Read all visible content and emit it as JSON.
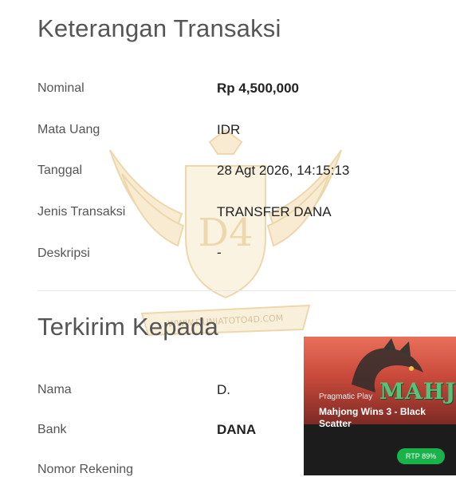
{
  "sections": {
    "transaction_title": "Keterangan Transaksi",
    "recipient_title": "Terkirim Kepada"
  },
  "transaction": [
    {
      "label": "Nominal",
      "value": "Rp 4,500,000"
    },
    {
      "label": "Mata Uang",
      "value": "IDR"
    },
    {
      "label": "Tanggal",
      "value": "28 Agt 2026, 14:15:13"
    },
    {
      "label": "Jenis Transaksi",
      "value": "TRANSFER DANA"
    },
    {
      "label": "Deskripsi",
      "value": "-"
    }
  ],
  "recipient": [
    {
      "label": "Nama",
      "value": "D."
    },
    {
      "label": "Bank",
      "value": "DANA"
    },
    {
      "label": "Nomor Rekening",
      "value": ""
    }
  ],
  "watermark": {
    "text": "WWW.DUNIATOTO4D.COM",
    "monogram": "D4"
  },
  "game_card": {
    "provider": "Pragmatic Play",
    "title": "Mahjong Wins 3 - Black Scatter",
    "logo_text": "MAHJONG",
    "rtp": "RTP 89%"
  },
  "colors": {
    "accent_green": "#19b34a",
    "watermark_gold": "#e0b85a"
  }
}
